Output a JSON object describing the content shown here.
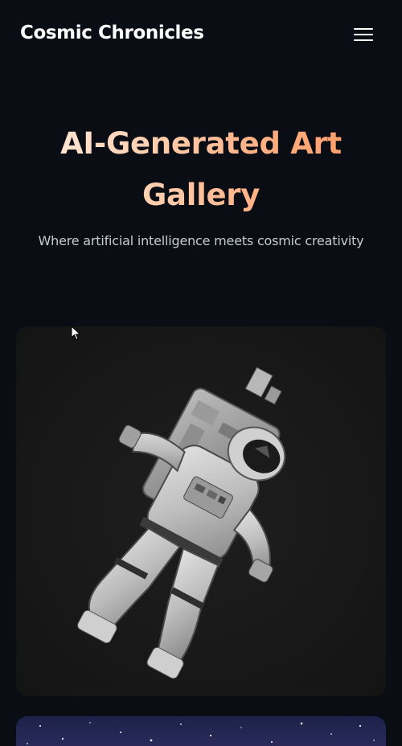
{
  "header": {
    "brand": "Cosmic Chronicles",
    "menu_icon": "hamburger-menu-icon"
  },
  "hero": {
    "title": "AI-Generated Art Gallery",
    "subtitle": "Where artificial intelligence meets cosmic creativity"
  },
  "gallery": {
    "items": [
      {
        "image": "astronaut-spacewalk-image"
      },
      {
        "image": "starfield-image"
      }
    ]
  },
  "colors": {
    "background": "#0a0d14",
    "title_gradient_start": "#ffeadc",
    "title_gradient_end": "#ff9a64",
    "subtitle": "#c6cad3",
    "card_background": "#1a1a1a"
  }
}
